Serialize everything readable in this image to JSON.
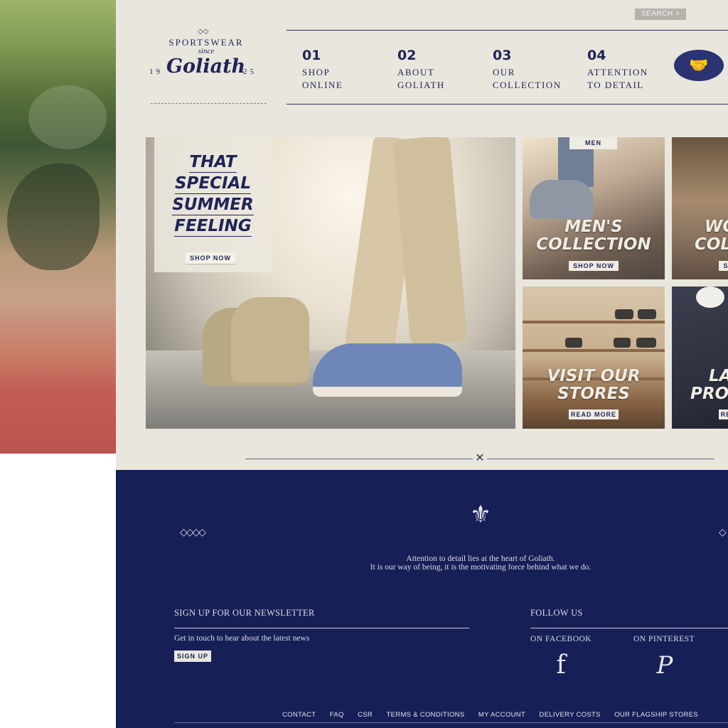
{
  "header": {
    "search_label": "SEARCH  >",
    "logo": {
      "sportswear": "SPORTSWEAR",
      "since": "since",
      "brand": "Goliath",
      "year_left": "19",
      "year_right": "25"
    }
  },
  "nav": [
    {
      "num": "01",
      "line1": "SHOP",
      "line2": "ONLINE"
    },
    {
      "num": "02",
      "line1": "ABOUT",
      "line2": "GOLIATH"
    },
    {
      "num": "03",
      "line1": "OUR",
      "line2": "COLLECTION"
    },
    {
      "num": "04",
      "line1": "ATTENTION",
      "line2": "TO DETAIL"
    }
  ],
  "hero": {
    "headline": [
      "THAT",
      "SPECIAL",
      "SUMMER",
      "FEELING"
    ],
    "button": "SHOP NOW"
  },
  "tiles": {
    "men": {
      "tag": "MEN",
      "title1": "MEN'S",
      "title2": "COLLECTION",
      "button": "SHOP NOW"
    },
    "women": {
      "title1": "WO",
      "title2": "COLL",
      "button": "S"
    },
    "stores": {
      "title1": "VISIT OUR",
      "title2": "STORES",
      "button": "READ MORE"
    },
    "promo": {
      "title1": "LA",
      "title2": "PROM",
      "button": "RE"
    }
  },
  "footer": {
    "tagline_line1": "Attention to detail lies at the heart of Goliath.",
    "tagline_line2": "It is our way of being, it is the motivating force behind what we do.",
    "newsletter_title": "SIGN UP FOR OUR NEWSLETTER",
    "newsletter_text": "Get in touch to hear about the latest news",
    "signup_button": "SIGN UP",
    "follow_title": "FOLLOW US",
    "facebook_label": "ON FACEBOOK",
    "pinterest_label": "ON PINTEREST",
    "links": [
      "CONTACT",
      "FAQ",
      "CSR",
      "TERMS & CONDITIONS",
      "MY ACCOUNT",
      "DELIVERY COSTS",
      "OUR FLAGSHIP STORES"
    ]
  },
  "colors": {
    "navy": "#171f57",
    "cream": "#e9e6dd",
    "text_navy": "#1f2457"
  },
  "icons": [
    "handshake-icon",
    "crest-icon",
    "facebook-icon",
    "pinterest-icon",
    "diamond-ornament-icon",
    "x-divider-icon"
  ]
}
